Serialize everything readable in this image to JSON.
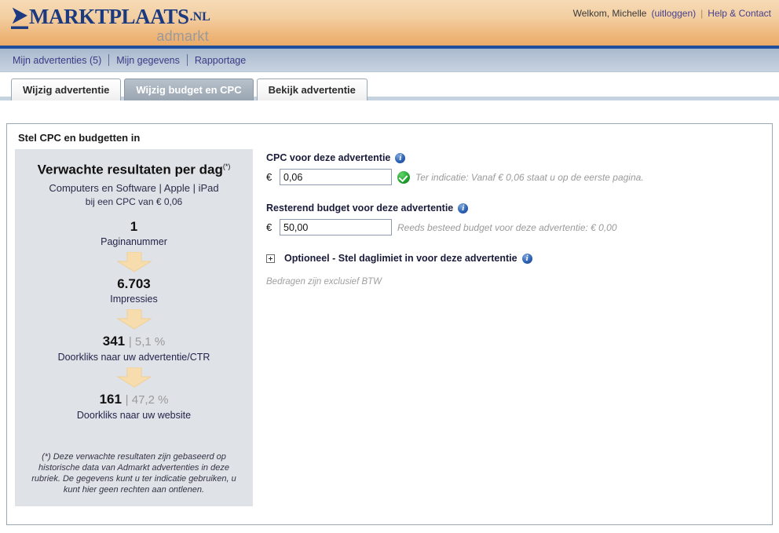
{
  "header": {
    "logo_chevron": "➤",
    "logo_main": "MARKTPLAATS",
    "logo_tld": ".NL",
    "logo_sub": "admarkt",
    "welcome": "Welkom, Michelle",
    "logout": "(uitloggen)",
    "separator": "|",
    "help": "Help & Contact"
  },
  "nav": {
    "items": [
      {
        "label": "Mijn advertenties (5)"
      },
      {
        "label": "Mijn gegevens"
      },
      {
        "label": "Rapportage"
      }
    ]
  },
  "tabs": [
    {
      "label": "Wijzig advertentie",
      "active": false
    },
    {
      "label": "Wijzig budget en CPC",
      "active": true
    },
    {
      "label": "Bekijk advertentie",
      "active": false
    }
  ],
  "panel": {
    "title": "Stel CPC en budgetten in"
  },
  "expected_results": {
    "title": "Verwachte resultaten per dag",
    "title_sup": "(*)",
    "category": "Computers en Software | Apple | iPad",
    "cpc_line": "bij een CPC van € 0,06",
    "metrics": [
      {
        "value": "1",
        "pct": "",
        "label": "Paginanummer"
      },
      {
        "value": "6.703",
        "pct": "",
        "label": "Impressies"
      },
      {
        "value": "341",
        "pct": "| 5,1 %",
        "label": "Doorkliks naar uw advertentie/CTR"
      },
      {
        "value": "161",
        "pct": "| 47,2 %",
        "label": "Doorkliks naar uw website"
      }
    ],
    "footnote": "(*) Deze verwachte resultaten zijn gebaseerd op historische data van Admarkt advertenties in deze rubriek. De gegevens kunt u ter indicatie gebruiken, u kunt hier geen rechten aan ontlenen."
  },
  "form": {
    "cpc_label": "CPC voor deze advertentie",
    "currency": "€",
    "cpc_value": "0,06",
    "cpc_hint": "Ter indicatie: Vanaf € 0,06 staat u op de eerste pagina.",
    "budget_label": "Resterend budget voor deze advertentie",
    "budget_value": "50,00",
    "budget_hint": "Reeds besteed budget voor deze advertentie: € 0,00",
    "optional_label": "Optioneel - Stel daglimiet in voor deze advertentie",
    "btw_note": "Bedragen zijn exclusief BTW"
  },
  "colors": {
    "brand_blue": "#1b3a80",
    "header_orange": "#eeb578",
    "accent_rule": "#1f4e9c",
    "panel_gray": "#dfe2e7",
    "arrow": "#f5d9a8",
    "ok_green": "#21a531",
    "info_blue": "#2f63b5"
  }
}
